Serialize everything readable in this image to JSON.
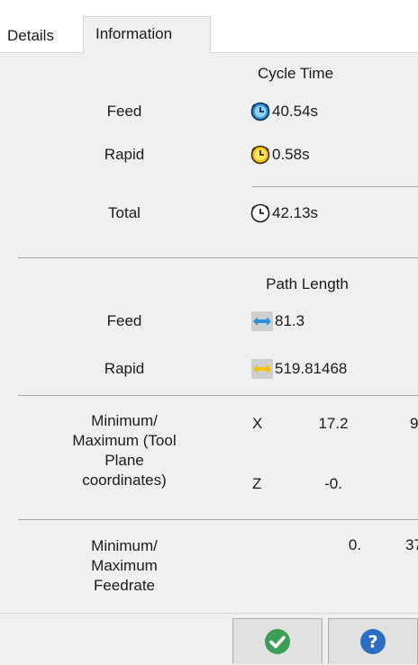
{
  "tabs": [
    {
      "label": "Details"
    },
    {
      "label": "Information"
    }
  ],
  "cycle_time": {
    "heading": "Cycle Time",
    "feed_label": "Feed",
    "feed_value": "40.54s",
    "rapid_label": "Rapid",
    "rapid_value": "0.58s",
    "total_label": "Total",
    "total_value": "42.13s"
  },
  "path_length": {
    "heading": "Path Length",
    "feed_label": "Feed",
    "feed_value": "81.3",
    "rapid_label": "Rapid",
    "rapid_value": "519.81468"
  },
  "minmax_coords": {
    "label": "Minimum/ Maximum (Tool Plane coordinates)",
    "x_label": "X",
    "x_min": "17.2",
    "x_max": "9",
    "z_label": "Z",
    "z_min": "-0."
  },
  "minmax_feedrate": {
    "label": "Minimum/ Maximum Feedrate",
    "min": "0.",
    "max": "37"
  },
  "icons": {
    "feed_time": "blue-clock-icon",
    "rapid_time": "yellow-clock-icon",
    "total_time": "clock-icon",
    "feed_length": "blue-double-arrow-icon",
    "rapid_length": "yellow-double-arrow-icon",
    "ok": "checkmark-icon",
    "help": "help-icon"
  },
  "colors": {
    "feed_blue": "#2f8fd8",
    "rapid_yellow": "#f5c400",
    "ok_green": "#3a9e57",
    "help_blue": "#2b6fc4"
  }
}
